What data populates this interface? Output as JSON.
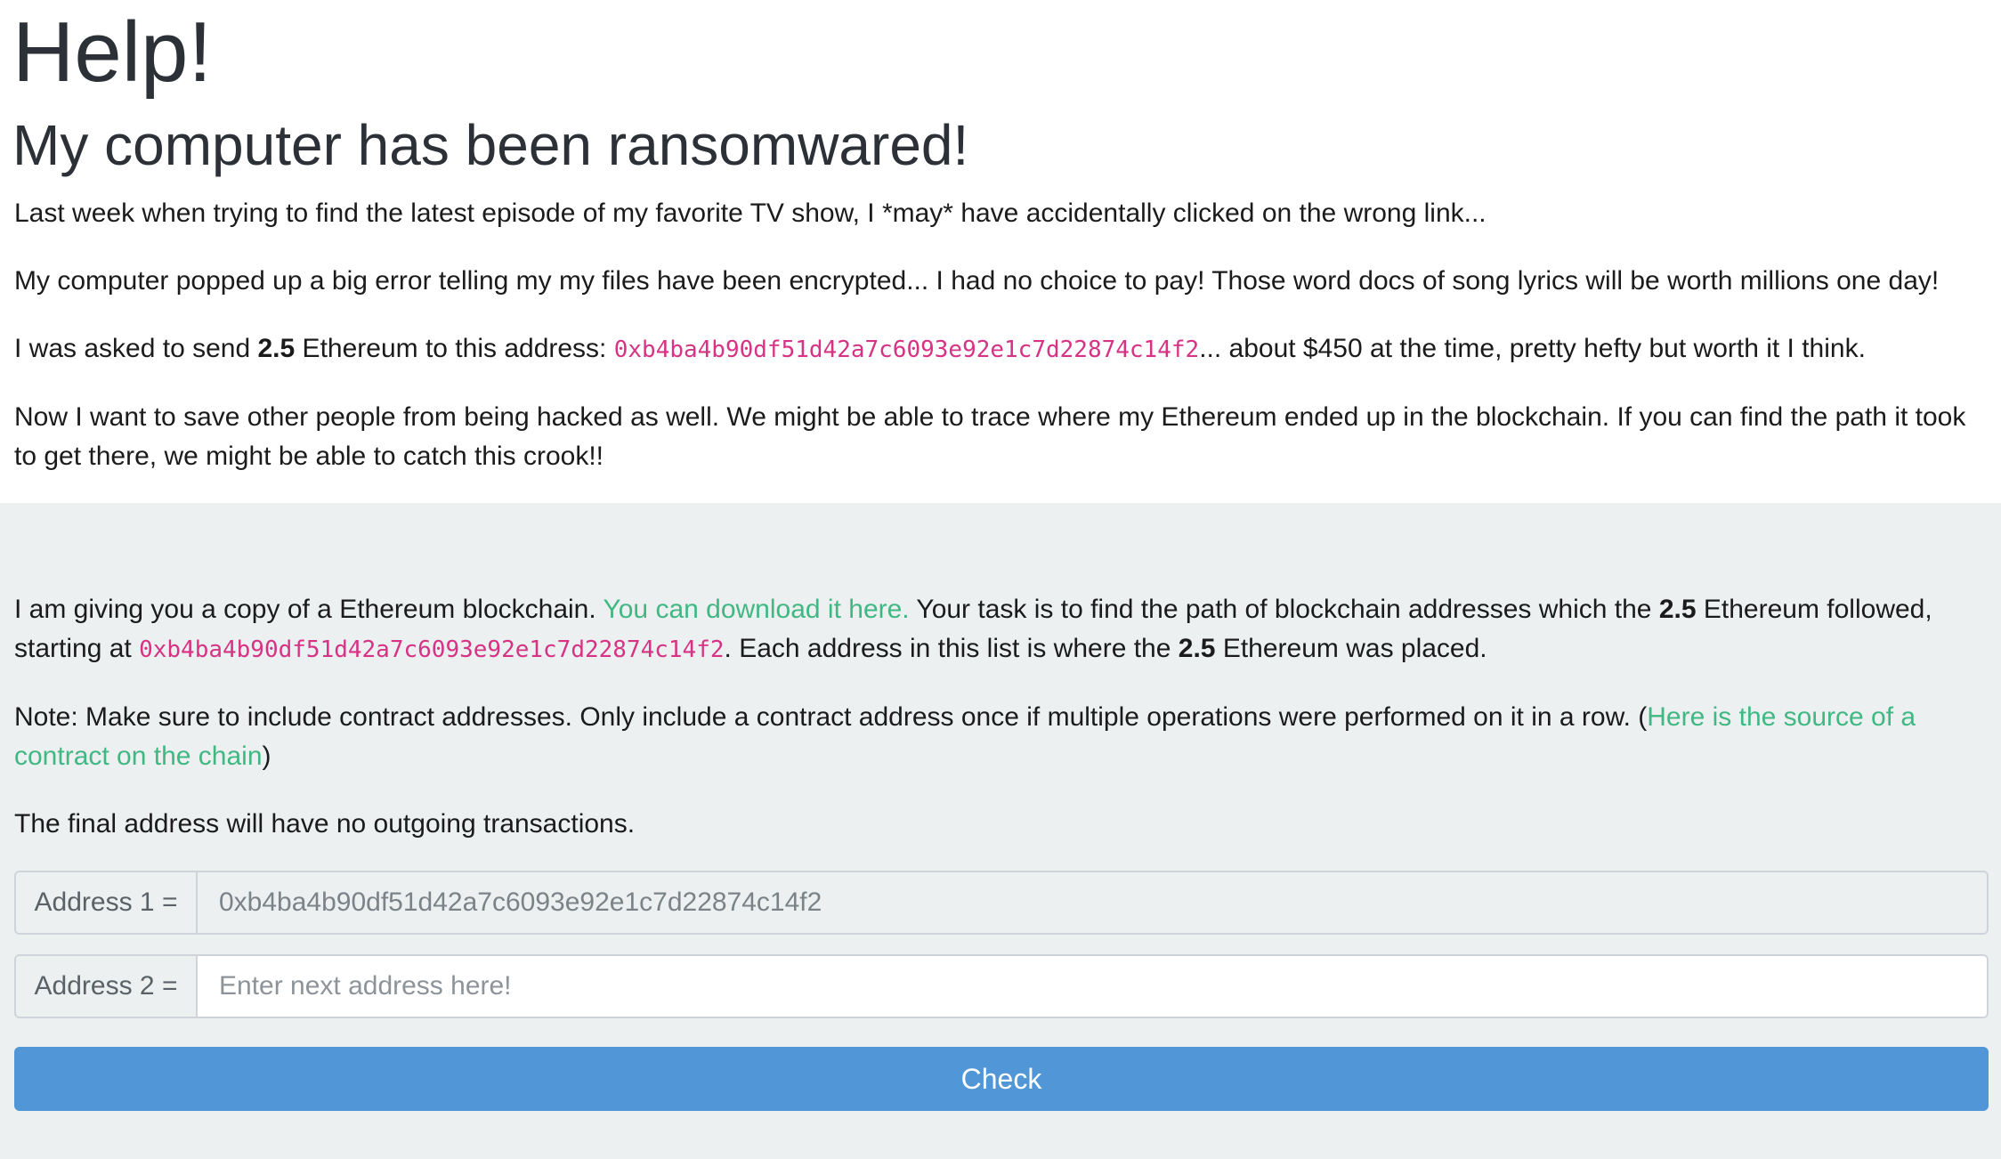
{
  "header": {
    "title": "Help!",
    "subtitle": "My computer has been ransomwared!"
  },
  "story": {
    "p1": "Last week when trying to find the latest episode of my favorite TV show, I *may* have accidentally clicked on the wrong link...",
    "p2": "My computer popped up a big error telling my my files have been encrypted... I had no choice to pay! Those word docs of song lyrics will be worth millions one day!",
    "p3_before": "I was asked to send ",
    "p3_amount": "2.5",
    "p3_middle": " Ethereum to this address: ",
    "p3_address": "0xb4ba4b90df51d42a7c6093e92e1c7d22874c14f2",
    "p3_after": "... about $450 at the time, pretty hefty but worth it I think.",
    "p4": "Now I want to save other people from being hacked as well. We might be able to trace where my Ethereum ended up in the blockchain. If you can find the path it took to get there, we might be able to catch this crook!!"
  },
  "task": {
    "p1_before": "I am giving you a copy of a Ethereum blockchain. ",
    "p1_link": "You can download it here.",
    "p1_middle": " Your task is to find the path of blockchain addresses which the ",
    "p1_amount": "2.5",
    "p1_middle2": " Ethereum followed, starting at ",
    "p1_address": "0xb4ba4b90df51d42a7c6093e92e1c7d22874c14f2",
    "p1_middle3": ". Each address in this list is where the ",
    "p1_amount2": "2.5",
    "p1_after": " Ethereum was placed.",
    "p2_before": "Note: Make sure to include contract addresses. Only include a contract address once if multiple operations were performed on it in a row. (",
    "p2_link": "Here is the source of a contract on the chain",
    "p2_after": ")",
    "p3": "The final address will have no outgoing transactions."
  },
  "form": {
    "address1_label": "Address 1 =",
    "address1_value": "0xb4ba4b90df51d42a7c6093e92e1c7d22874c14f2",
    "address2_label": "Address 2 =",
    "address2_placeholder": "Enter next address here!",
    "check_label": "Check"
  },
  "colors": {
    "link": "#41b883",
    "code": "#d63384",
    "button": "#5197d7",
    "panel": "#ecf0f1"
  }
}
